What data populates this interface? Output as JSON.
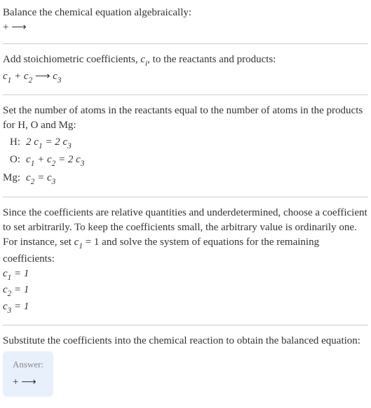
{
  "intro": {
    "line1": "Balance the chemical equation algebraically:",
    "line2_left": " + ",
    "line2_arrow": "⟶"
  },
  "step1": {
    "text": "Add stoichiometric coefficients, ",
    "ci": "c",
    "ci_sub": "i",
    "text2": ", to the reactants and products:",
    "eq_prefix1": "c",
    "eq_sub1": "1",
    "eq_mid": " + ",
    "eq_prefix2": "c",
    "eq_sub2": "2",
    "eq_arrow": " ⟶ ",
    "eq_prefix3": "c",
    "eq_sub3": "3"
  },
  "step2": {
    "text": "Set the number of atoms in the reactants equal to the number of atoms in the products for H, O and Mg:",
    "rows": [
      {
        "label": "H:",
        "lhs1": "2 ",
        "c1": "c",
        "s1": "1",
        "mid": " = 2 ",
        "c2": "c",
        "s2": "3"
      },
      {
        "label": "O:",
        "c1": "c",
        "s1": "1",
        "plus": " + ",
        "c2": "c",
        "s2": "2",
        "eq": " = 2 ",
        "c3": "c",
        "s3": "3"
      },
      {
        "label": "Mg:",
        "c1": "c",
        "s1": "2",
        "eq": " = ",
        "c2": "c",
        "s2": "3"
      }
    ]
  },
  "step3": {
    "text": "Since the coefficients are relative quantities and underdetermined, choose a coefficient to set arbitrarily. To keep the coefficients small, the arbitrary value is ordinarily one. For instance, set ",
    "c": "c",
    "csub": "1",
    "text2": " = 1 and solve the system of equations for the remaining coefficients:",
    "sol": [
      {
        "c": "c",
        "s": "1",
        "val": " = 1"
      },
      {
        "c": "c",
        "s": "2",
        "val": " = 1"
      },
      {
        "c": "c",
        "s": "3",
        "val": " = 1"
      }
    ]
  },
  "step4": {
    "text": "Substitute the coefficients into the chemical reaction to obtain the balanced equation:"
  },
  "answer": {
    "label": "Answer:",
    "eq_left": " + ",
    "eq_arrow": "⟶"
  }
}
